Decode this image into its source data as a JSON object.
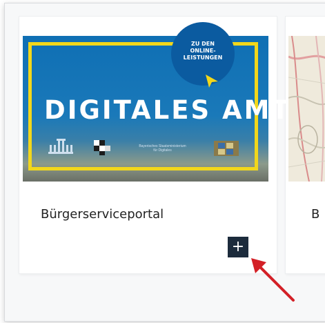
{
  "banner": {
    "title": "DIGITALES AMT",
    "badge_lines": [
      "ZU DEN",
      "ONLINE-",
      "LEISTUNGEN"
    ],
    "ministry_lines": [
      "Bayerisches Staatsministerium",
      "für Digitales"
    ]
  },
  "cards": [
    {
      "title": "Bürgerserviceportal",
      "add_label": "+"
    },
    {
      "title": "B"
    }
  ],
  "colors": {
    "banner_blue": "#0f6fb4",
    "banner_border": "#f2d71b",
    "button_bg": "#1c2b3c",
    "annotation_arrow": "#d32027"
  },
  "icons": [
    "cursor-arrow-icon",
    "building-icon",
    "ministry-logo-icon",
    "bavaria-crest-icon",
    "plus-icon",
    "annotation-arrow-icon"
  ]
}
